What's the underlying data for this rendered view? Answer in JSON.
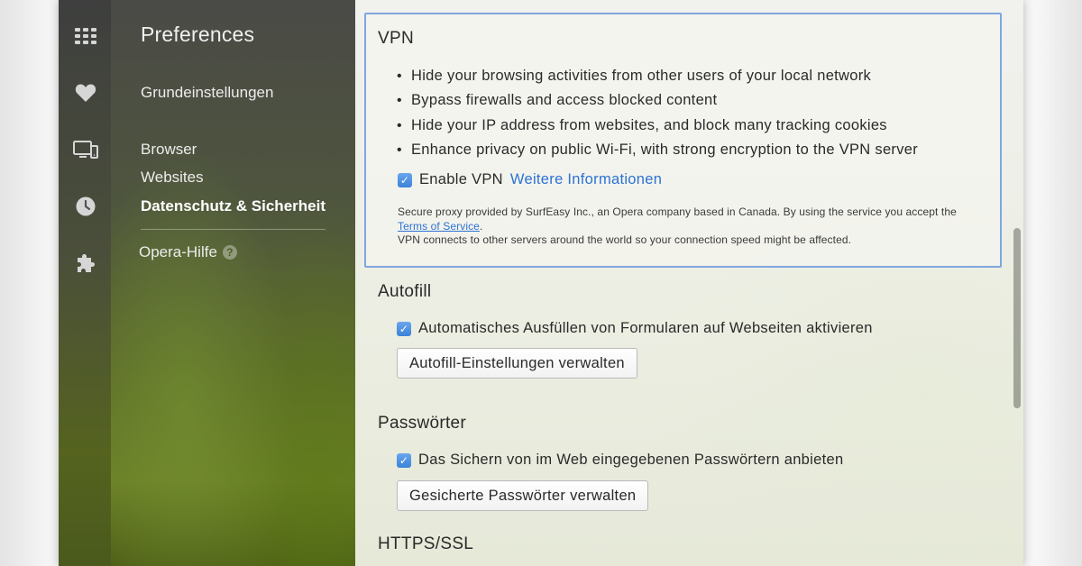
{
  "rail": {
    "icons": [
      "speed-dial-icon",
      "heart-icon",
      "devices-icon",
      "history-icon",
      "extensions-icon"
    ]
  },
  "sidebar": {
    "title": "Preferences",
    "items": [
      {
        "label": "Grundeinstellungen"
      },
      {
        "label": "Browser"
      },
      {
        "label": "Websites"
      },
      {
        "label": "Datenschutz & Sicherheit",
        "active": true
      }
    ],
    "help": {
      "label": "Opera-Hilfe",
      "icon": "?"
    }
  },
  "vpn": {
    "title": "VPN",
    "bullets": [
      "Hide your browsing activities from other users of your local network",
      "Bypass firewalls and access blocked content",
      "Hide your IP address from websites, and block many tracking cookies",
      "Enhance privacy on public Wi-Fi, with strong encryption to the VPN server"
    ],
    "enable_label": "Enable VPN",
    "enable_checked": true,
    "more_info_link": "Weitere Informationen",
    "note_part1": "Secure proxy provided by SurfEasy Inc., an Opera company based in Canada. By using the service you accept the",
    "note_tos": "Terms of Service",
    "note_period": ".",
    "note_part2": "VPN connects to other servers around the world so your connection speed might be affected."
  },
  "autofill": {
    "title": "Autofill",
    "checkbox_label": "Automatisches Ausfüllen von Formularen auf Webseiten aktivieren",
    "checked": true,
    "button_label": "Autofill-Einstellungen verwalten"
  },
  "passwords": {
    "title": "Passwörter",
    "checkbox_label": "Das Sichern von im Web eingegebenen Passwörtern anbieten",
    "checked": true,
    "button_label": "Gesicherte Passwörter verwalten"
  },
  "https": {
    "title": "HTTPS/SSL"
  },
  "colors": {
    "accent": "#3b82d8",
    "link": "#2c73d3",
    "focus_border": "#7fa7e0"
  }
}
